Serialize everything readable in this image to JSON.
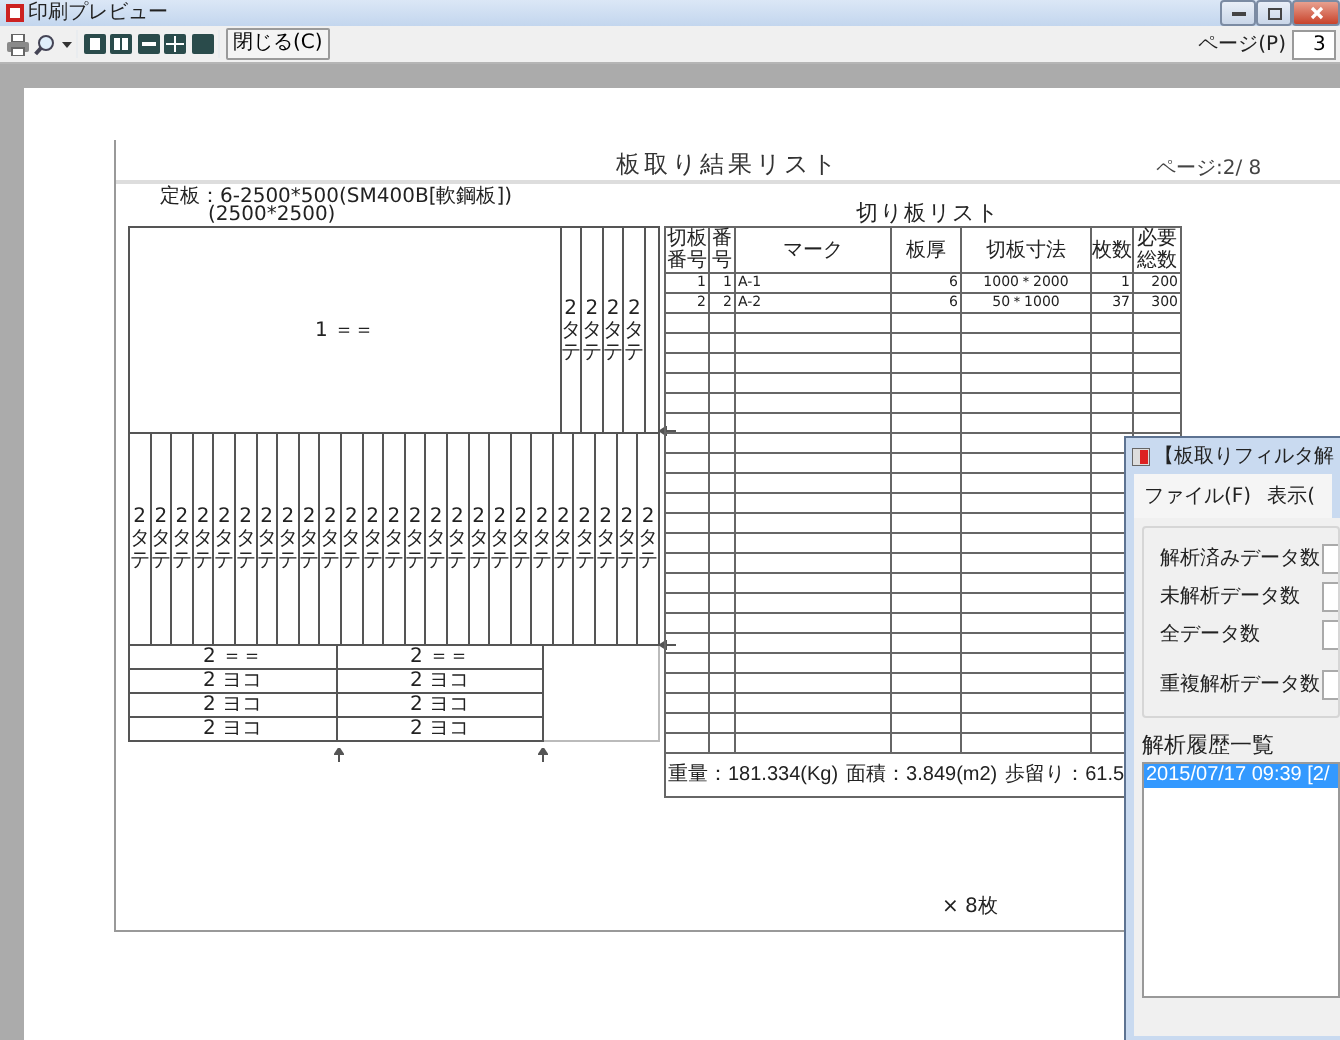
{
  "window": {
    "title": "印刷プレビュー"
  },
  "toolbar": {
    "close_button": "閉じる(C)",
    "page_label": "ページ(P)",
    "page_value": "3"
  },
  "report": {
    "title": "板取り結果リスト",
    "page": "ページ:2/ 8",
    "plate_spec": "定板：6-2500*500(SM400B[軟鋼板])",
    "plate_size": "(2500*2500)",
    "layout": {
      "main_piece": "1 ＝＝",
      "top_strips": [
        "2 タテ",
        "2 タテ",
        "2 タテ",
        "2 タテ"
      ],
      "middle_strips": [
        "2 タテ",
        "2 タテ",
        "2 タテ",
        "2 タテ",
        "2 タテ",
        "2 タテ",
        "2 タテ",
        "2 タテ",
        "2 タテ",
        "2 タテ",
        "2 タテ",
        "2 タテ",
        "2 タテ",
        "2 タテ",
        "2 タテ",
        "2 タテ",
        "2 タテ",
        "2 タテ",
        "2 タテ",
        "2 タテ",
        "2 タテ",
        "2 タテ",
        "2 タテ",
        "2 タテ",
        "2 タテ"
      ],
      "bottom_rows": [
        [
          "2 ＝＝",
          "2 ＝＝"
        ],
        [
          "2 ヨコ",
          "2 ヨコ"
        ],
        [
          "2 ヨコ",
          "2 ヨコ"
        ],
        [
          "2 ヨコ",
          "2 ヨコ"
        ]
      ]
    },
    "cut_list": {
      "title": "切り板リスト",
      "columns": [
        "切板番号",
        "番号",
        "マーク",
        "板厚",
        "切板寸法",
        "枚数",
        "必要総数"
      ],
      "rows": [
        [
          "1",
          "1",
          "A-1",
          "6",
          "1000＊2000",
          "1",
          "200"
        ],
        [
          "2",
          "2",
          "A-2",
          "6",
          "50＊1000",
          "37",
          "300"
        ]
      ],
      "weight": "重量：181.334(Kg)",
      "area": "面積：3.849(m2)",
      "yield": "歩留り：61.5"
    },
    "multiplier": "× 8枚"
  },
  "filter_window": {
    "title": "【板取りフィルタ解",
    "menu": [
      "ファイル(F)",
      "表示("
    ],
    "stats": [
      "解析済みデータ数",
      "未解析データ数",
      "全データ数",
      "重複解析データ数"
    ],
    "history_label": "解析履歴一覧",
    "history": [
      {
        "text": "2015/07/17 09:39 [2/",
        "selected": true
      }
    ]
  }
}
